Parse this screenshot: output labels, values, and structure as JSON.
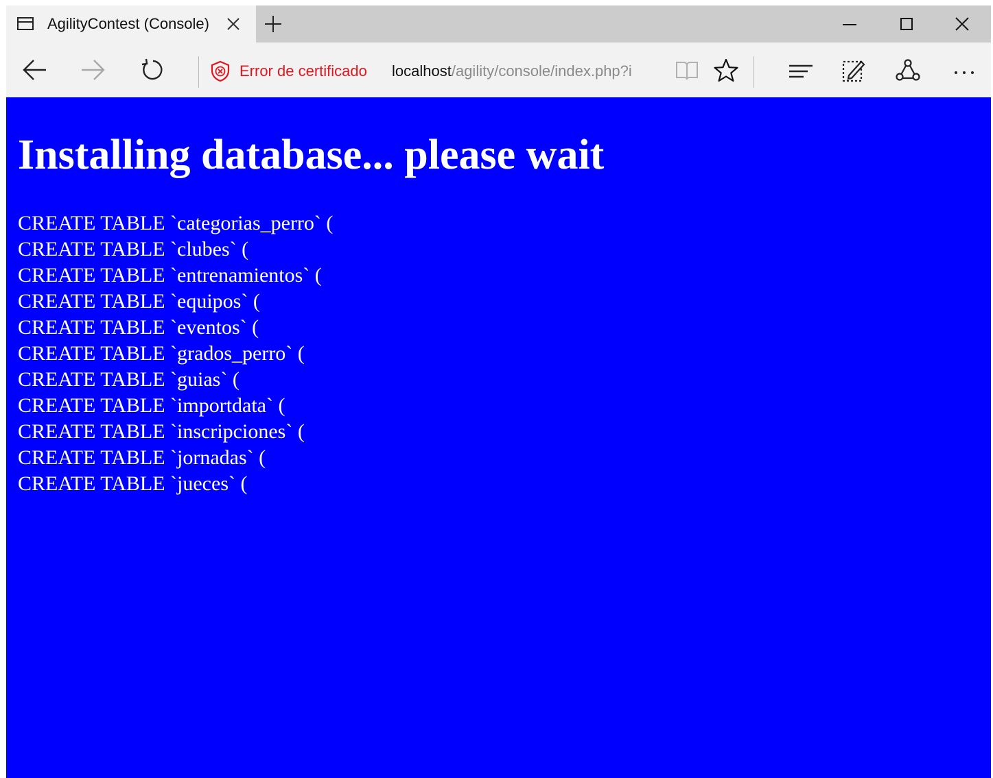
{
  "browser": {
    "tab": {
      "title": "AgilityContest (Console)",
      "page_icon": "page-icon",
      "close_icon": "close-icon"
    },
    "new_tab_icon": "plus-icon",
    "window_controls": [
      "minimize-icon",
      "maximize-icon",
      "close-icon"
    ],
    "nav": {
      "back_icon": "back-arrow-icon",
      "forward_icon": "forward-arrow-icon",
      "reload_icon": "reload-icon",
      "cert_icon": "shield-error-icon",
      "cert_error_text": "Error de certificado",
      "url_host": "localhost",
      "url_path": "/agility/console/index.php?i",
      "reading_view_icon": "book-icon",
      "favorite_icon": "star-icon",
      "hub_icon": "hub-icon",
      "web_note_icon": "web-note-icon",
      "share_icon": "share-icon",
      "more_icon": "more-icon"
    },
    "colors": {
      "cert_error": "#e0161e",
      "page_background": "#0000ff",
      "page_text": "#ffffff"
    }
  },
  "page": {
    "heading": "Installing database... please wait",
    "lines": [
      "CREATE TABLE `categorias_perro` (",
      "CREATE TABLE `clubes` (",
      "CREATE TABLE `entrenamientos` (",
      "CREATE TABLE `equipos` (",
      "CREATE TABLE `eventos` (",
      "CREATE TABLE `grados_perro` (",
      "CREATE TABLE `guias` (",
      "CREATE TABLE `importdata` (",
      "CREATE TABLE `inscripciones` (",
      "CREATE TABLE `jornadas` (",
      "CREATE TABLE `jueces` ("
    ]
  }
}
